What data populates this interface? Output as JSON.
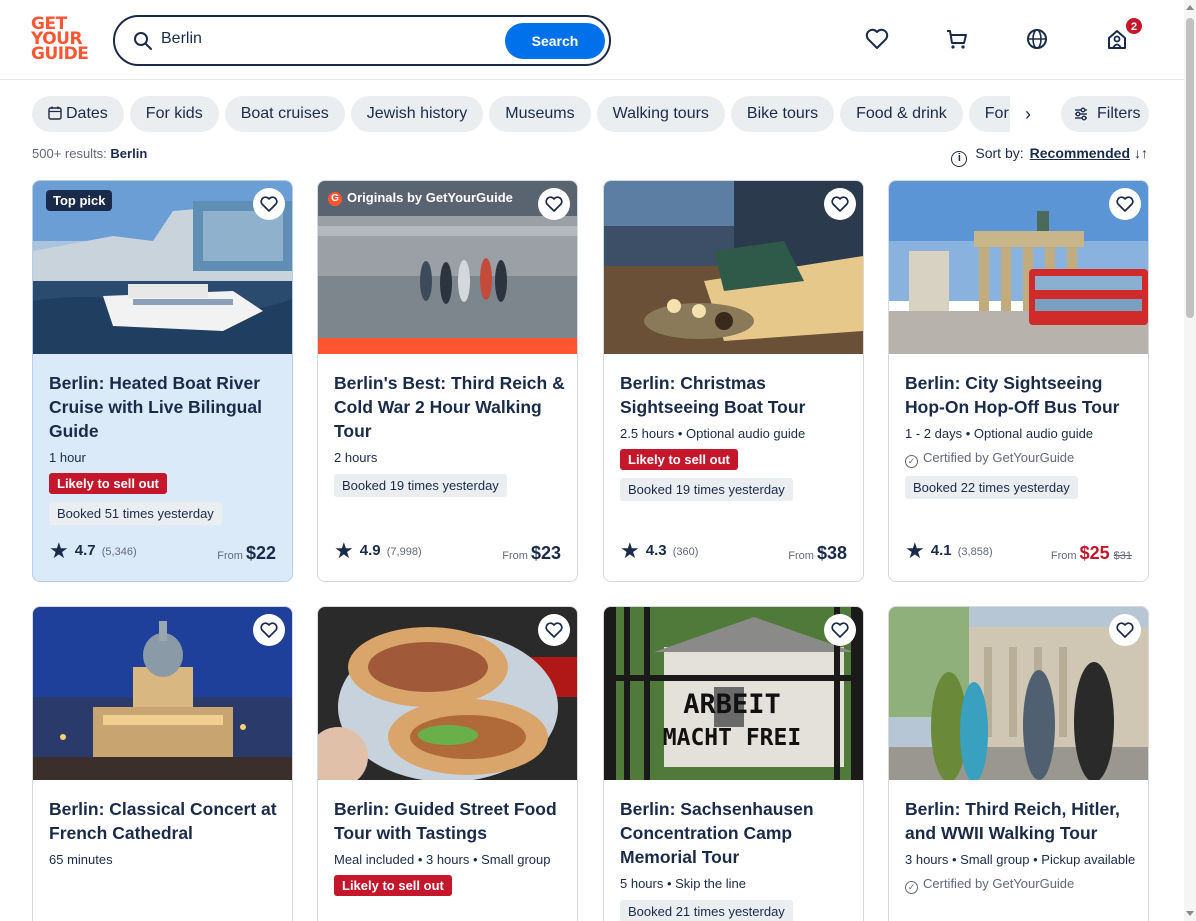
{
  "header": {
    "logo": [
      "GET",
      "YOUR",
      "GUIDE"
    ],
    "search_value": "Berlin",
    "search_button": "Search",
    "cart_badge": "2",
    "icons": [
      "heart-icon",
      "cart-icon",
      "globe-icon",
      "profile-icon"
    ]
  },
  "chips": [
    "Dates",
    "For kids",
    "Boat cruises",
    "Jewish history",
    "Museums",
    "Walking tours",
    "Bike tours",
    "Food & drink",
    "For r"
  ],
  "filters_label": "Filters",
  "results": {
    "prefix": "500+ results:",
    "query": "Berlin"
  },
  "sort": {
    "label": "Sort by:",
    "value": "Recommended"
  },
  "colors": {
    "brand": "#ff5533",
    "primary": "#0071eb",
    "navy": "#1a2b49",
    "alert": "#c4172c"
  },
  "cards": [
    {
      "tag": "Top pick",
      "title": "Berlin: Heated Boat River Cruise with Live Bilingual Guide",
      "meta": "1 hour",
      "sell": "Likely to sell out",
      "booked": "Booked 51 times yesterday",
      "rating": "4.7",
      "reviews": "(5,346)",
      "from": "From",
      "price": "$22"
    },
    {
      "tag": "Originals by GetYourGuide",
      "title": "Berlin's Best: Third Reich & Cold War 2 Hour Walking Tour",
      "meta": "2 hours",
      "booked": "Booked 19 times yesterday",
      "rating": "4.9",
      "reviews": "(7,998)",
      "from": "From",
      "price": "$23"
    },
    {
      "title": "Berlin: Christmas Sightseeing Boat Tour",
      "meta": "2.5 hours • Optional audio guide",
      "sell": "Likely to sell out",
      "booked": "Booked 19 times yesterday",
      "rating": "4.3",
      "reviews": "(360)",
      "from": "From",
      "price": "$38"
    },
    {
      "title": "Berlin: City Sightseeing Hop-On Hop-Off Bus Tour",
      "meta": "1 - 2 days • Optional audio guide",
      "certified": "Certified by GetYourGuide",
      "booked": "Booked 22 times yesterday",
      "rating": "4.1",
      "reviews": "(3,858)",
      "from": "From",
      "price": "$25",
      "old_price": "$31"
    },
    {
      "title": "Berlin: Classical Concert at French Cathedral",
      "meta": "65 minutes"
    },
    {
      "title": "Berlin: Guided Street Food Tour with Tastings",
      "meta": "Meal included • 3 hours • Small group",
      "sell": "Likely to sell out"
    },
    {
      "title": "Berlin: Sachsenhausen Concentration Camp Memorial Tour",
      "meta": "5 hours • Skip the line",
      "booked": "Booked 21 times yesterday",
      "sign_text": [
        "ARBEIT",
        "MACHT FREI"
      ]
    },
    {
      "title": "Berlin: Third Reich, Hitler, and WWII Walking Tour",
      "meta": "3 hours • Small group • Pickup available",
      "certified": "Certified by GetYourGuide"
    }
  ]
}
